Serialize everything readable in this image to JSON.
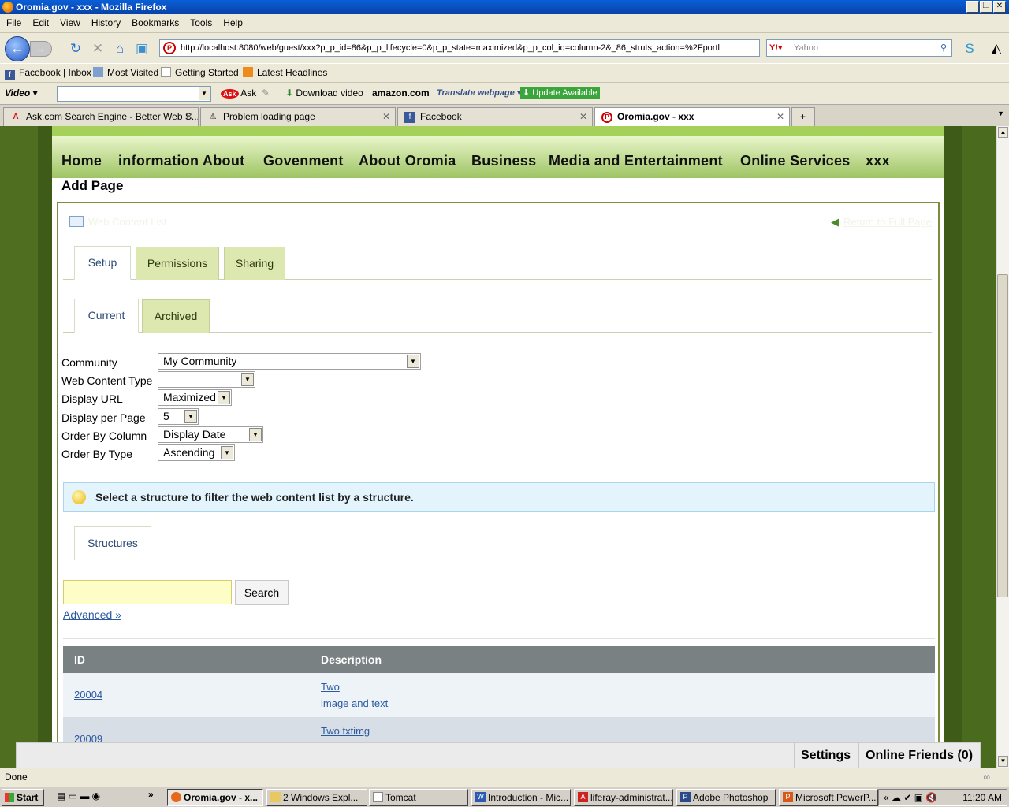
{
  "window": {
    "title": "Oromia.gov - xxx - Mozilla Firefox"
  },
  "menu": [
    "File",
    "Edit",
    "View",
    "History",
    "Bookmarks",
    "Tools",
    "Help"
  ],
  "nav": {
    "url": "http://localhost:8080/web/guest/xxx?p_p_id=86&p_p_lifecycle=0&p_p_state=maximized&p_p_col_id=column-2&_86_struts_action=%2Fportl",
    "search_placeholder": "Yahoo"
  },
  "bookmarks": [
    "Facebook | Inbox",
    "Most Visited",
    "Getting Started",
    "Latest Headlines"
  ],
  "toolbar3": {
    "video": "Video",
    "ask": "Ask",
    "download": "Download video",
    "amazon": "amazon.com",
    "translate": "Translate webpage",
    "update": "Update Available"
  },
  "tabs": [
    {
      "label": "Ask.com Search Engine - Better Web S..."
    },
    {
      "label": "Problem loading page"
    },
    {
      "label": "Facebook"
    },
    {
      "label": "Oromia.gov - xxx"
    }
  ],
  "site_nav": [
    "Home",
    "information About",
    "Govenment",
    "About Oromia",
    "Business",
    "Media and Entertainment",
    "Online Services",
    "xxx"
  ],
  "page_title": "Add Page",
  "portlet": {
    "title": "Web Content List",
    "return_link": "Return to Full Page",
    "tabs1": [
      "Setup",
      "Permissions",
      "Sharing"
    ],
    "tabs2": [
      "Current",
      "Archived"
    ],
    "form": [
      {
        "label": "Community",
        "value": "My Community"
      },
      {
        "label": "Web Content Type",
        "value": ""
      },
      {
        "label": "Display URL",
        "value": "Maximized"
      },
      {
        "label": "Display per Page",
        "value": "5"
      },
      {
        "label": "Order By Column",
        "value": "Display Date"
      },
      {
        "label": "Order By Type",
        "value": "Ascending"
      }
    ],
    "info": "Select a structure to filter the web content list by a structure.",
    "tabs3": [
      "Structures"
    ],
    "search_button": "Search",
    "advanced_link": "Advanced »",
    "table": {
      "headers": [
        "ID",
        "Description"
      ],
      "rows": [
        {
          "id": "20004",
          "desc1": "Two",
          "desc2": "image and text"
        },
        {
          "id": "20009",
          "desc1": "Two txtimg",
          "desc2": ""
        }
      ]
    }
  },
  "dock": {
    "settings": "Settings",
    "friends": "Online Friends (0)"
  },
  "status": "Done",
  "taskbar": {
    "start": "Start",
    "items": [
      "Oromia.gov - x...",
      "2 Windows Expl...",
      "Tomcat",
      "Introduction - Mic...",
      "liferay-administrat...",
      "Adobe Photoshop",
      "Microsoft PowerP..."
    ],
    "clock": "11:20 AM"
  },
  "colors": {
    "accent_green": "#a5d15a",
    "link_blue": "#2b5aa0",
    "table_header": "#7a8182"
  }
}
